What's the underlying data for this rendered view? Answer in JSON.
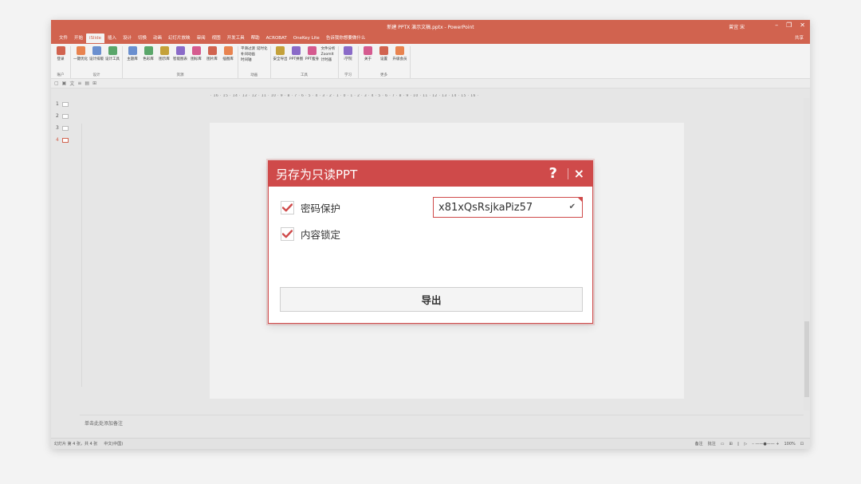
{
  "app": {
    "window_title": "新建 PPTX 演示文稿.pptx - PowerPoint",
    "user": "曾宜 宋"
  },
  "menu": {
    "tabs": [
      "文件",
      "开始",
      "iSlide",
      "插入",
      "设计",
      "切换",
      "动画",
      "幻灯片放映",
      "审阅",
      "视图",
      "开发工具",
      "帮助",
      "ACROBAT",
      "OneKey Lite"
    ],
    "active_index": 2,
    "tell_me": "告诉我你想要做什么",
    "share": "共享"
  },
  "ribbon": {
    "groups": [
      {
        "name": "账户",
        "items": [
          {
            "label": "登录",
            "icon": "user-icon"
          }
        ]
      },
      {
        "name": "设计",
        "items": [
          {
            "label": "一键优化",
            "icon": "optimize-icon"
          },
          {
            "label": "设计排版",
            "icon": "layout-icon"
          },
          {
            "label": "设计工具",
            "icon": "tools-icon"
          }
        ]
      },
      {
        "name": "资源",
        "items": [
          {
            "label": "主题库",
            "icon": "theme-icon"
          },
          {
            "label": "色彩库",
            "icon": "color-icon"
          },
          {
            "label": "图示库",
            "icon": "diagram-icon"
          },
          {
            "label": "智能图表",
            "icon": "chart-icon"
          },
          {
            "label": "图标库",
            "icon": "icon-lib-icon"
          },
          {
            "label": "图片库",
            "icon": "image-icon"
          },
          {
            "label": "插图库",
            "icon": "illustration-icon"
          }
        ]
      },
      {
        "name": "动画",
        "list": [
          "平滑过渡",
          "补间动画",
          "时间轴"
        ],
        "list2": [
          "延时化"
        ]
      },
      {
        "name": "工具",
        "items": [
          {
            "label": "安全导出",
            "icon": "export-icon"
          },
          {
            "label": "PPT拼图",
            "icon": "puzzle-icon"
          },
          {
            "label": "PPT瘦身",
            "icon": "slim-icon"
          }
        ],
        "list": [
          "文件分析",
          "ZoomIt",
          "计时器"
        ]
      },
      {
        "name": "学习",
        "items": [
          {
            "label": "i学院",
            "icon": "learn-icon"
          }
        ]
      },
      {
        "name": "更多",
        "items": [
          {
            "label": "关于",
            "icon": "about-icon"
          },
          {
            "label": "设置",
            "icon": "settings-icon"
          },
          {
            "label": "升级会员",
            "icon": "vip-icon"
          }
        ]
      }
    ]
  },
  "ruler": {
    "horizontal": "· 16 · 15 · 14 · 13 · 12 · 11 · 10 · 9 · 8 · 7 · 6 · 5 · 4 · 3 · 2 · 1 · 0 · 1 · 2 · 3 · 4 · 5 · 6 · 7 · 8 · 9 · 10 · 11 · 12 · 13 · 14 · 15 · 16 ·"
  },
  "slides": [
    "1",
    "2",
    "3",
    "4"
  ],
  "active_slide": "4",
  "notes_placeholder": "单击此处添加备注",
  "status": {
    "slide_info": "幻灯片 第 4 张，共 4 张",
    "language": "中文(中国)",
    "notes": "备注",
    "comments": "批注",
    "zoom": "100%"
  },
  "dialog": {
    "title": "另存为只读PPT",
    "help_label": "?",
    "close_label": "×",
    "password_checkbox_label": "密码保护",
    "password_checked": true,
    "password_value": "x81xQsRsjkaPiz57",
    "lock_checkbox_label": "内容锁定",
    "lock_checked": true,
    "export_label": "导出",
    "accent_color": "#cf4a4a"
  }
}
